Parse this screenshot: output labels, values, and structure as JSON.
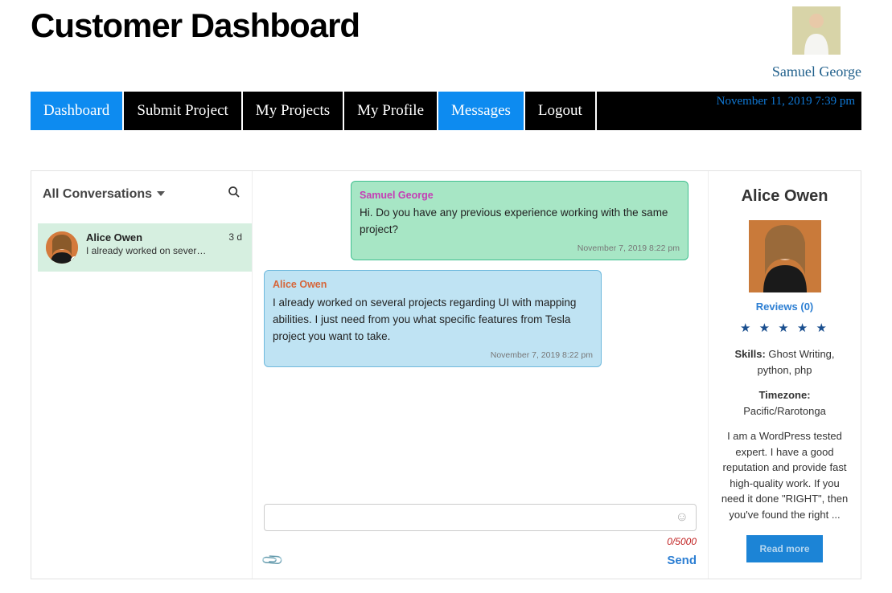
{
  "header": {
    "title": "Customer Dashboard",
    "user_name": "Samuel George",
    "timestamp": "November 11, 2019 7:39 pm"
  },
  "nav": {
    "dashboard": "Dashboard",
    "submit": "Submit Project",
    "myprojects": "My Projects",
    "myprofile": "My Profile",
    "messages": "Messages",
    "logout": "Logout"
  },
  "left": {
    "title": "All Conversations",
    "items": [
      {
        "name": "Alice Owen",
        "snippet": "I already worked on sever…",
        "time": "3 d"
      }
    ]
  },
  "chat": {
    "msg1": {
      "sender": "Samuel George",
      "text": "Hi. Do you have any previous experience working with the same project?",
      "time": "November 7, 2019 8:22 pm"
    },
    "msg2": {
      "sender": "Alice Owen",
      "text": "I already worked on several projects regarding UI with mapping abilities. I just need from you what specific features from Tesla project you want to take.",
      "time": "November 7, 2019 8:22 pm"
    },
    "compose_placeholder": "",
    "char_count": "0/5000",
    "send": "Send"
  },
  "right": {
    "name": "Alice Owen",
    "reviews": "Reviews (0)",
    "stars": "★ ★ ★ ★ ★",
    "skills_label": "Skills:",
    "skills": " Ghost Writing, python, php",
    "tz_label": "Timezone:",
    "tz": " Pacific/Rarotonga",
    "bio": "I am a WordPress tested expert. I have a good reputation and provide fast high-quality work. If you need it done \"RIGHT\", then you've found the right ...",
    "readmore": "Read more"
  }
}
